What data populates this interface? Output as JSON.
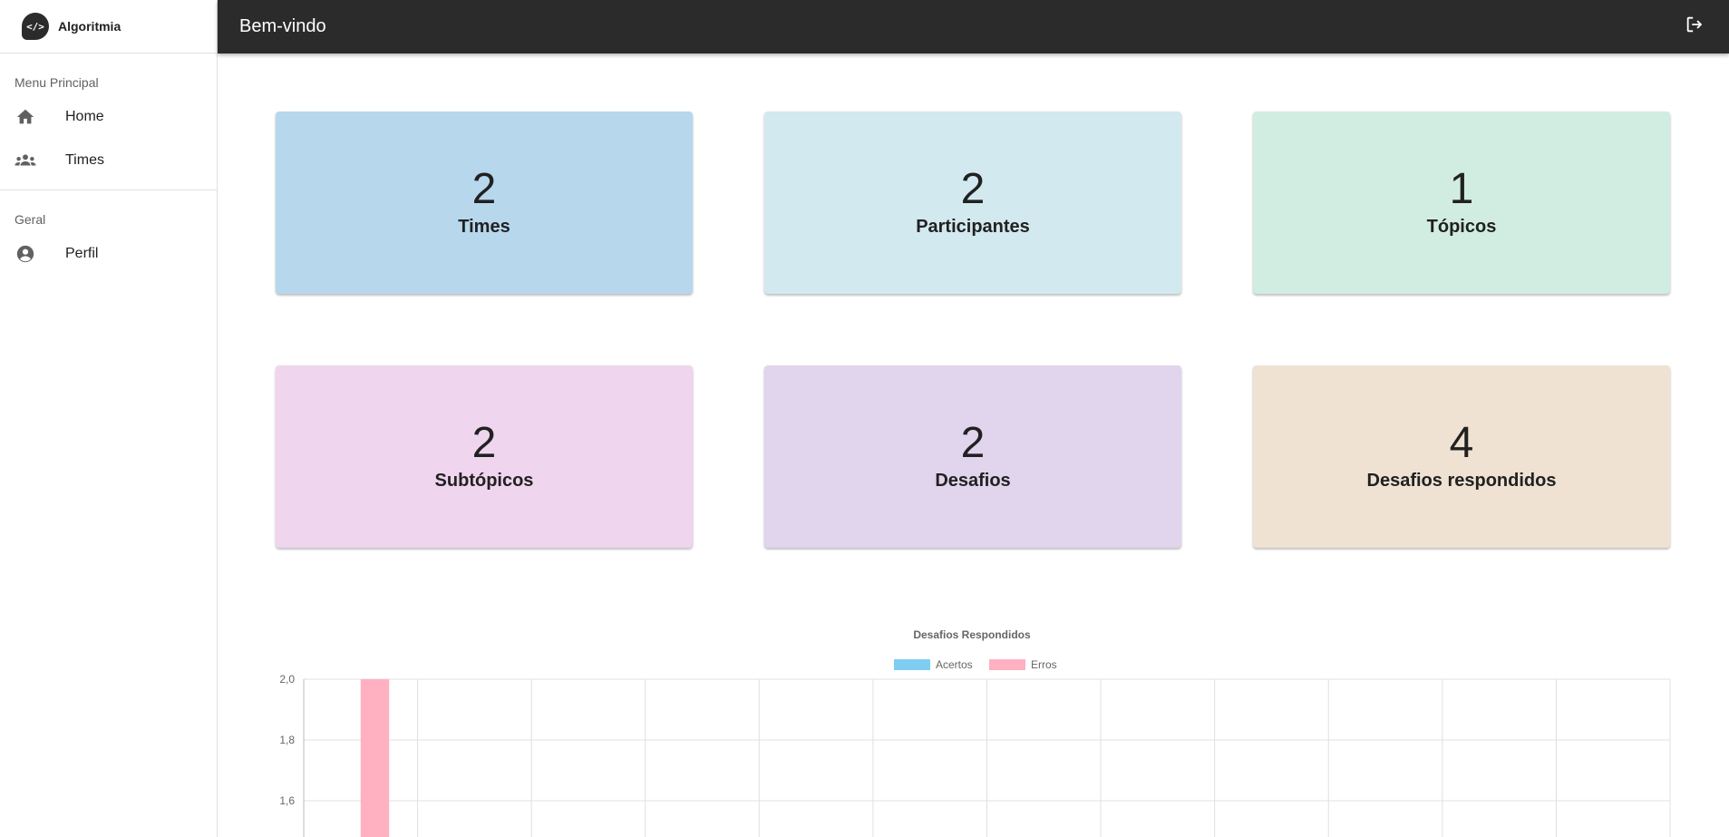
{
  "app": {
    "name": "Algoritmia",
    "logo_text": "</>"
  },
  "topbar": {
    "title": "Bem-vindo",
    "logout_icon": "logout-icon"
  },
  "sidebar": {
    "sections": [
      {
        "title": "Menu Principal",
        "items": [
          {
            "label": "Home",
            "icon": "home-icon"
          },
          {
            "label": "Times",
            "icon": "group-icon"
          }
        ]
      },
      {
        "title": "Geral",
        "items": [
          {
            "label": "Perfil",
            "icon": "account-circle-icon"
          }
        ]
      }
    ]
  },
  "cards": [
    {
      "value": "2",
      "label": "Times",
      "color": "#b7d7ed"
    },
    {
      "value": "2",
      "label": "Participantes",
      "color": "#d2e9ef"
    },
    {
      "value": "1",
      "label": "Tópicos",
      "color": "#d1ede1"
    },
    {
      "value": "2",
      "label": "Subtópicos",
      "color": "#efd5ed"
    },
    {
      "value": "2",
      "label": "Desafios",
      "color": "#e1d4ed"
    },
    {
      "value": "4",
      "label": "Desafios respondidos",
      "color": "#efe2d3"
    }
  ],
  "chart_data": {
    "type": "bar",
    "title": "Desafios Respondidos",
    "xlabel": "",
    "ylabel": "",
    "ylim": [
      1.5,
      2.0
    ],
    "y_ticks": [
      "2,0",
      "1,8",
      "1,6"
    ],
    "categories": [
      "",
      "",
      "",
      "",
      "",
      "",
      "",
      "",
      "",
      "",
      "",
      ""
    ],
    "legend_position": "top",
    "grid": true,
    "series": [
      {
        "name": "Acertos",
        "color": "#7fcdf2",
        "values": [
          0,
          0,
          0,
          0,
          0,
          0,
          0,
          0,
          0,
          0,
          0,
          0
        ]
      },
      {
        "name": "Erros",
        "color": "#ffb0c1",
        "values": [
          2,
          0,
          0,
          0,
          0,
          0,
          0,
          0,
          0,
          0,
          0,
          0
        ]
      }
    ]
  }
}
